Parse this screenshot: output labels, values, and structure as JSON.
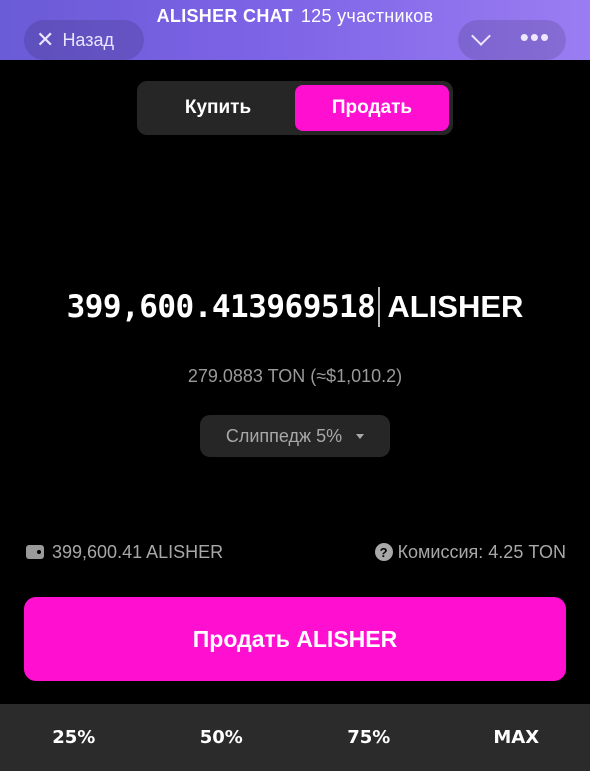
{
  "header": {
    "chat_name": "ALISHER CHAT",
    "members": "125 участников",
    "back_icon": "close-icon",
    "back_label": "Назад",
    "chevron_icon": "chevron-down-icon",
    "menu_icon": "more-icon",
    "menu_glyph": "•••",
    "accent_gradient": [
      "#6a5bd6",
      "#9a7df2"
    ]
  },
  "tabs": {
    "buy": "Купить",
    "sell": "Продать",
    "active": "sell"
  },
  "amount": {
    "value": "399,600.413969518",
    "ticker": "ALISHER"
  },
  "conversion": "279.0883 TON (≈$1,010.2)",
  "slippage": {
    "label": "Слиппедж 5%"
  },
  "info": {
    "balance": "399,600.41 ALISHER",
    "commission": "Комиссия: 4.25 TON",
    "help_glyph": "?"
  },
  "action": {
    "label": "Продать ALISHER",
    "color": "#ff0fd0"
  },
  "quick_amounts": [
    "25%",
    "50%",
    "75%",
    "MAX"
  ]
}
